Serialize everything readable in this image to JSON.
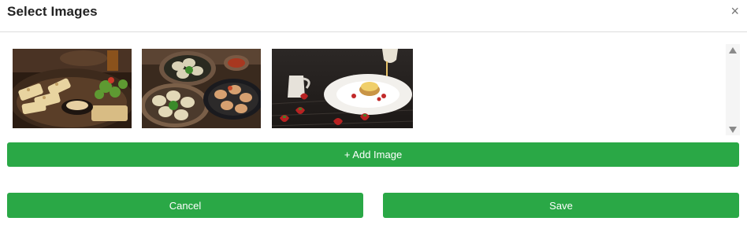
{
  "dialog": {
    "title": "Select Images",
    "close_glyph": "×"
  },
  "gallery": {
    "images": [
      {
        "subject": "grilled bread platter with salad and dip"
      },
      {
        "subject": "dumplings in bowls with dipping sauce"
      },
      {
        "subject": "dessert on white plate with sauce being poured, strawberries"
      }
    ]
  },
  "buttons": {
    "add_image": "+ Add Image",
    "cancel": "Cancel",
    "save": "Save"
  },
  "colors": {
    "accent": "#2aa846",
    "divider": "#dcdcdc"
  }
}
